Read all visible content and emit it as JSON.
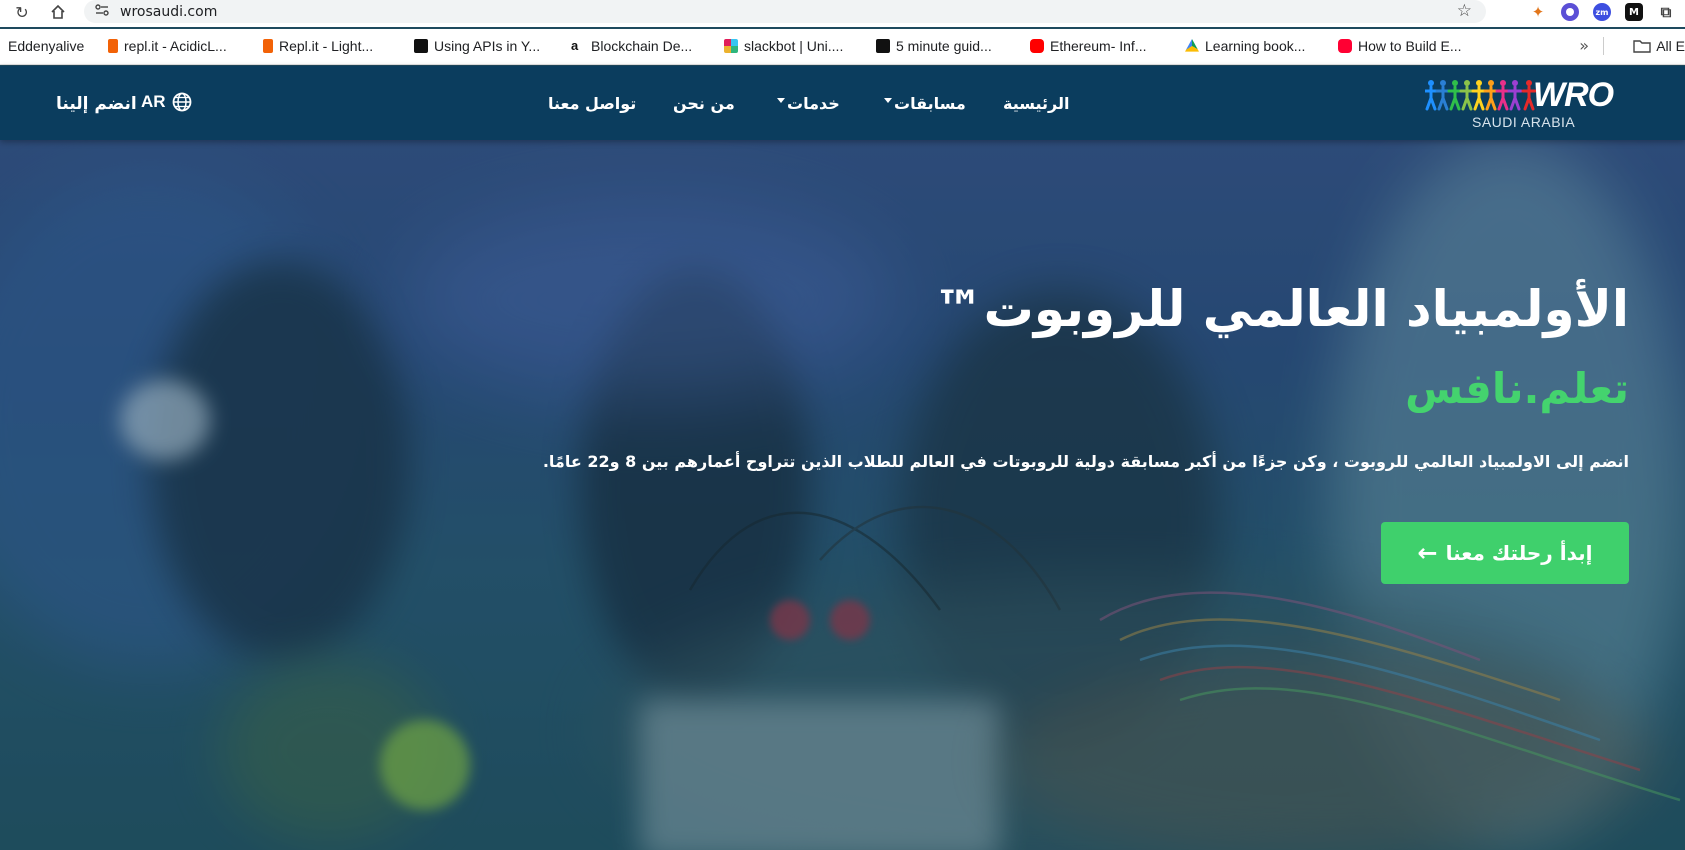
{
  "browser": {
    "url": "wrosaudi.com",
    "bookmarks": [
      {
        "label": "Eddenyalive",
        "color": "#ffffff"
      },
      {
        "label": "repl.it - AcidicL...",
        "color": "#f26207"
      },
      {
        "label": "Repl.it - Light...",
        "color": "#f26207"
      },
      {
        "label": "Using APIs in Y...",
        "color": "#111111"
      },
      {
        "label": "Blockchain De...",
        "color": "#111111"
      },
      {
        "label": "slackbot | Uni....",
        "color": "#36c5f0"
      },
      {
        "label": "5 minute guid...",
        "color": "#111111"
      },
      {
        "label": "Ethereum- Inf...",
        "color": "#ff0000"
      },
      {
        "label": "Learning book...",
        "color": "#0f9d58"
      },
      {
        "label": "How to Build E...",
        "color": "#ff0033"
      }
    ],
    "all_bookmarks_label": "All E"
  },
  "header": {
    "logo_word": "WRO",
    "logo_sub": "SAUDI ARABIA",
    "nav": {
      "home": "الرئيسية",
      "competitions": "مسابقات",
      "services": "خدمات",
      "about": "من نحن",
      "contact": "تواصل معنا"
    },
    "lang": "AR",
    "join": "انضم إلينا"
  },
  "hero": {
    "title": "الأولمبياد العالمي للروبوت™",
    "subtitle": "تعلم.نافس",
    "description": "انضم إلى الاولمبياد العالمي للروبوت ، وكن جزءًا من أكبر مسابقة دولية للروبوتات في العالم للطلاب الذين تتراوح أعمارهم بين 8 و22 عامًا.",
    "cta": "إبدأ رحلتك معنا",
    "accent_color": "#3fd06c"
  }
}
